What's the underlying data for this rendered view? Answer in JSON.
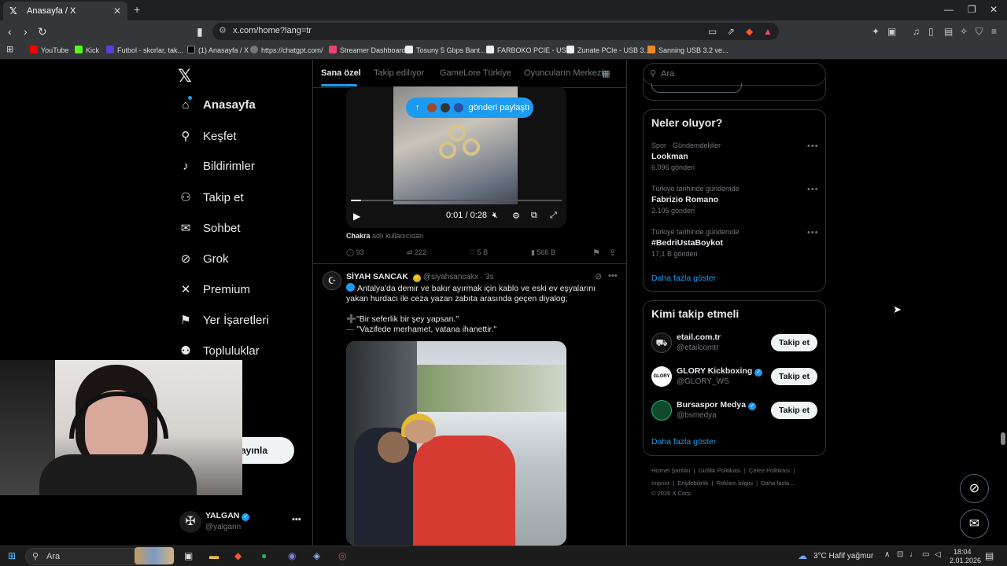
{
  "browser": {
    "tab_title": "Anasayfa / X",
    "url": "x.com/home?lang=tr",
    "bookmarks": [
      {
        "label": "YouTube",
        "color": "#ff0000"
      },
      {
        "label": "Kick",
        "color": "#53fc18"
      },
      {
        "label": "Futbol - skorlar, tak...",
        "color": "#5a3fd6"
      },
      {
        "label": "(1) Anasayfa / X",
        "color": "#000000"
      },
      {
        "label": "https://chatgpt.com/",
        "color": "#777777"
      },
      {
        "label": "Streamer Dashboard",
        "color": "#e9436b"
      },
      {
        "label": "Tosuny 5 Gbps Bant...",
        "color": "#eeeeee"
      },
      {
        "label": "FARBOKO PCIE - US...",
        "color": "#eeeeee"
      },
      {
        "label": "Zunate PCIe - USB 3...",
        "color": "#eeeeee"
      },
      {
        "label": "Sanning USB 3.2 ve...",
        "color": "#f08a24"
      }
    ]
  },
  "nav": {
    "items": [
      {
        "label": "Anasayfa",
        "icon": "home-icon"
      },
      {
        "label": "Keşfet",
        "icon": "search-icon"
      },
      {
        "label": "Bildirimler",
        "icon": "bell-icon"
      },
      {
        "label": "Takip et",
        "icon": "add-user-icon"
      },
      {
        "label": "Sohbet",
        "icon": "mail-icon"
      },
      {
        "label": "Grok",
        "icon": "grok-icon"
      },
      {
        "label": "Premium",
        "icon": "x-icon"
      },
      {
        "label": "Yer İşaretleri",
        "icon": "bookmark-icon"
      },
      {
        "label": "Topluluklar",
        "icon": "community-icon"
      }
    ],
    "more_partial": "zla",
    "post_partial": "ayınla",
    "account": {
      "name": "YALGAN",
      "handle": "@yalgann"
    }
  },
  "feed": {
    "tabs": [
      "Sana özel",
      "Takip edilıyor",
      "GameLore Türkiye",
      "Oyuncuların Merkezi"
    ],
    "new_posts_pill": "gönderi paylaştı",
    "video": {
      "time": "0:01 / 0:28"
    },
    "source": {
      "user": "Chakra",
      "suffix": "adlı kullanıcıdan"
    },
    "post1_stats": {
      "replies": "93",
      "reposts": "222",
      "likes": "5 B",
      "views": "566 B"
    },
    "post2": {
      "author": "SİYAH SANCAK",
      "handle": "@siyahsancakx",
      "time": "3s",
      "text1": "Antalya'da demir ve bakır ayırmak için kablo ve eski ev eşyalarını yakan hurdacı ile ceza yazan zabıta arasında geçen diyalog;",
      "quote1": "\"Bir seferlik bir şey yapsan.\"",
      "quote2": "\"Vazifede merhamet, vatana ihanettir.\""
    }
  },
  "right": {
    "search_placeholder": "Ara",
    "trending_title": "Neler oluyor?",
    "trends": [
      {
        "meta": "Spor · Gündemdekiler",
        "name": "Lookman",
        "count": "6.096 gönderi"
      },
      {
        "meta": "Türkiye tarihinde gündemde",
        "name": "Fabrizio Romano",
        "count": "2.105 gönderi"
      },
      {
        "meta": "Türkiye tarihinde gündemde",
        "name": "#BedriUstaBoykot",
        "count": "17,1 B gönderi"
      }
    ],
    "show_more": "Daha fazla göster",
    "wtf_title": "Kimi takip etmeli",
    "wtf": [
      {
        "name": "etail.com.tr",
        "handle": "@etailcomtr",
        "verified": false
      },
      {
        "name": "GLORY Kickboxing",
        "handle": "@GLORY_WS",
        "verified": true
      },
      {
        "name": "Bursaspor Medya",
        "handle": "@bsmedya",
        "verified": true
      }
    ],
    "follow_label": "Takip et",
    "footer1": [
      "Hizmet Şartları",
      "Gizlilik Politikası",
      "Çerez Politikası"
    ],
    "footer2": [
      "Imprint",
      "Erişilebilirlik",
      "Reklam bilgisi",
      "Daha fazla ..."
    ],
    "copyright": "© 2026 X Corp."
  },
  "taskbar": {
    "search": "Ara",
    "weather": "3°C  Hafif yağmur",
    "time": "18:04",
    "date": "2.01.2026"
  }
}
